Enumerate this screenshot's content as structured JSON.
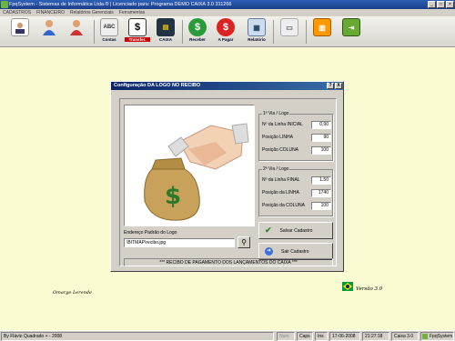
{
  "window": {
    "title": "FpqSystem - Sistemas de Informática Ltda.® | Licenciado para: Programa DEMO CAIXA 3.0 311266"
  },
  "menu": [
    "CADASTROS",
    "FINANCEIRO",
    "Relatórios Gerenciais",
    "Ferramentas"
  ],
  "toolbar": {
    "contas": "Contas",
    "transfer": "Transfer.",
    "caixa": "CAIXA",
    "receber": "Receber",
    "pagar": "A Pagar",
    "relatorio": "Relatório"
  },
  "dialog": {
    "title": "Configuração DA LOGO NO RECIBO",
    "help": "?",
    "close": "X",
    "via1": {
      "legend": "1ª Via / Logo",
      "rows": [
        {
          "label": "Nº da Linha INICIAL",
          "value": "0,90"
        },
        {
          "label": "Posição LINHA",
          "value": "90"
        },
        {
          "label": "Posição COLUNA",
          "value": "100"
        }
      ]
    },
    "via2": {
      "legend": "2ª Via / Logo",
      "rows": [
        {
          "label": "Nº da Linha FINAL",
          "value": "1.50"
        },
        {
          "label": "Posição da LINHA",
          "value": "1740"
        },
        {
          "label": "Posição da COLUNA",
          "value": "100"
        }
      ]
    },
    "address_label": "Endereço Padrão do Logo",
    "address_value": "\\BITMAP\\recibo.jpg",
    "save": "Salvar Cadastro",
    "exit": "Sair Cadastro",
    "recibo_caption": "*** RECIBO DE PAGAMENTO DOS LANÇAMENTOS DO CAIXA ***",
    "image_symbol": "$"
  },
  "desktop": {
    "signature": "Omarge Lerende",
    "version": "Versão 3.0"
  },
  "status": {
    "user": "By Flávio Quadrado + - 2008",
    "num": "Num",
    "caps": "Caps",
    "ins": "Ins",
    "date": "17-06-2008",
    "time": "21:27:18",
    "caixa": "Caixa 3.0",
    "app": "FpqSystem"
  },
  "colors": {
    "accent": "#0a246a",
    "desktop": "#fafad2",
    "titlebar": "#1c3f8a"
  }
}
